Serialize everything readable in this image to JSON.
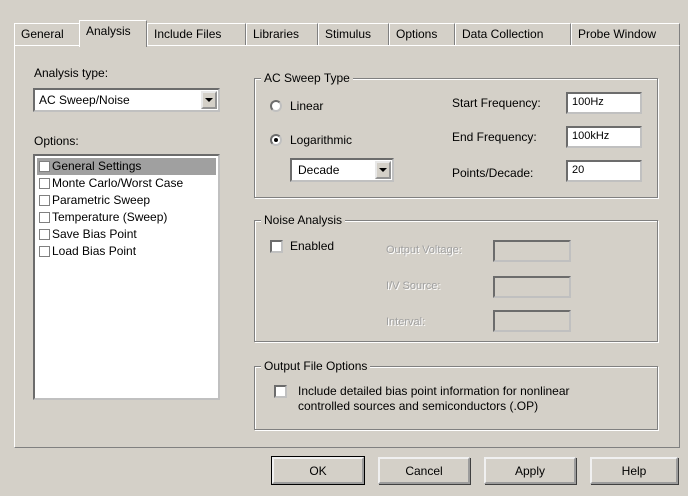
{
  "tabs": [
    "General",
    "Analysis",
    "Include Files",
    "Libraries",
    "Stimulus",
    "Options",
    "Data Collection",
    "Probe Window"
  ],
  "analysis_type": {
    "label": "Analysis type:",
    "value": "AC Sweep/Noise"
  },
  "options": {
    "label": "Options:",
    "items": [
      "General Settings",
      "Monte Carlo/Worst Case",
      "Parametric Sweep",
      "Temperature (Sweep)",
      "Save Bias Point",
      "Load Bias Point"
    ]
  },
  "ac_sweep": {
    "title": "AC Sweep Type",
    "linear_label": "Linear",
    "log_label": "Logarithmic",
    "log_scale_value": "Decade",
    "start_label": "Start Frequency:",
    "start_value": "100Hz",
    "end_label": "End Frequency:",
    "end_value": "100kHz",
    "points_label": "Points/Decade:",
    "points_value": "20"
  },
  "noise": {
    "title": "Noise Analysis",
    "enabled_label": "Enabled",
    "output_voltage_label": "Output Voltage:",
    "iv_source_label": "I/V Source:",
    "interval_label": "Interval:"
  },
  "output_file": {
    "title": "Output File Options",
    "line1": "Include detailed bias point information for nonlinear",
    "line2": "controlled sources and semiconductors (.OP)"
  },
  "buttons": {
    "ok": "OK",
    "cancel": "Cancel",
    "apply": "Apply",
    "help": "Help"
  }
}
